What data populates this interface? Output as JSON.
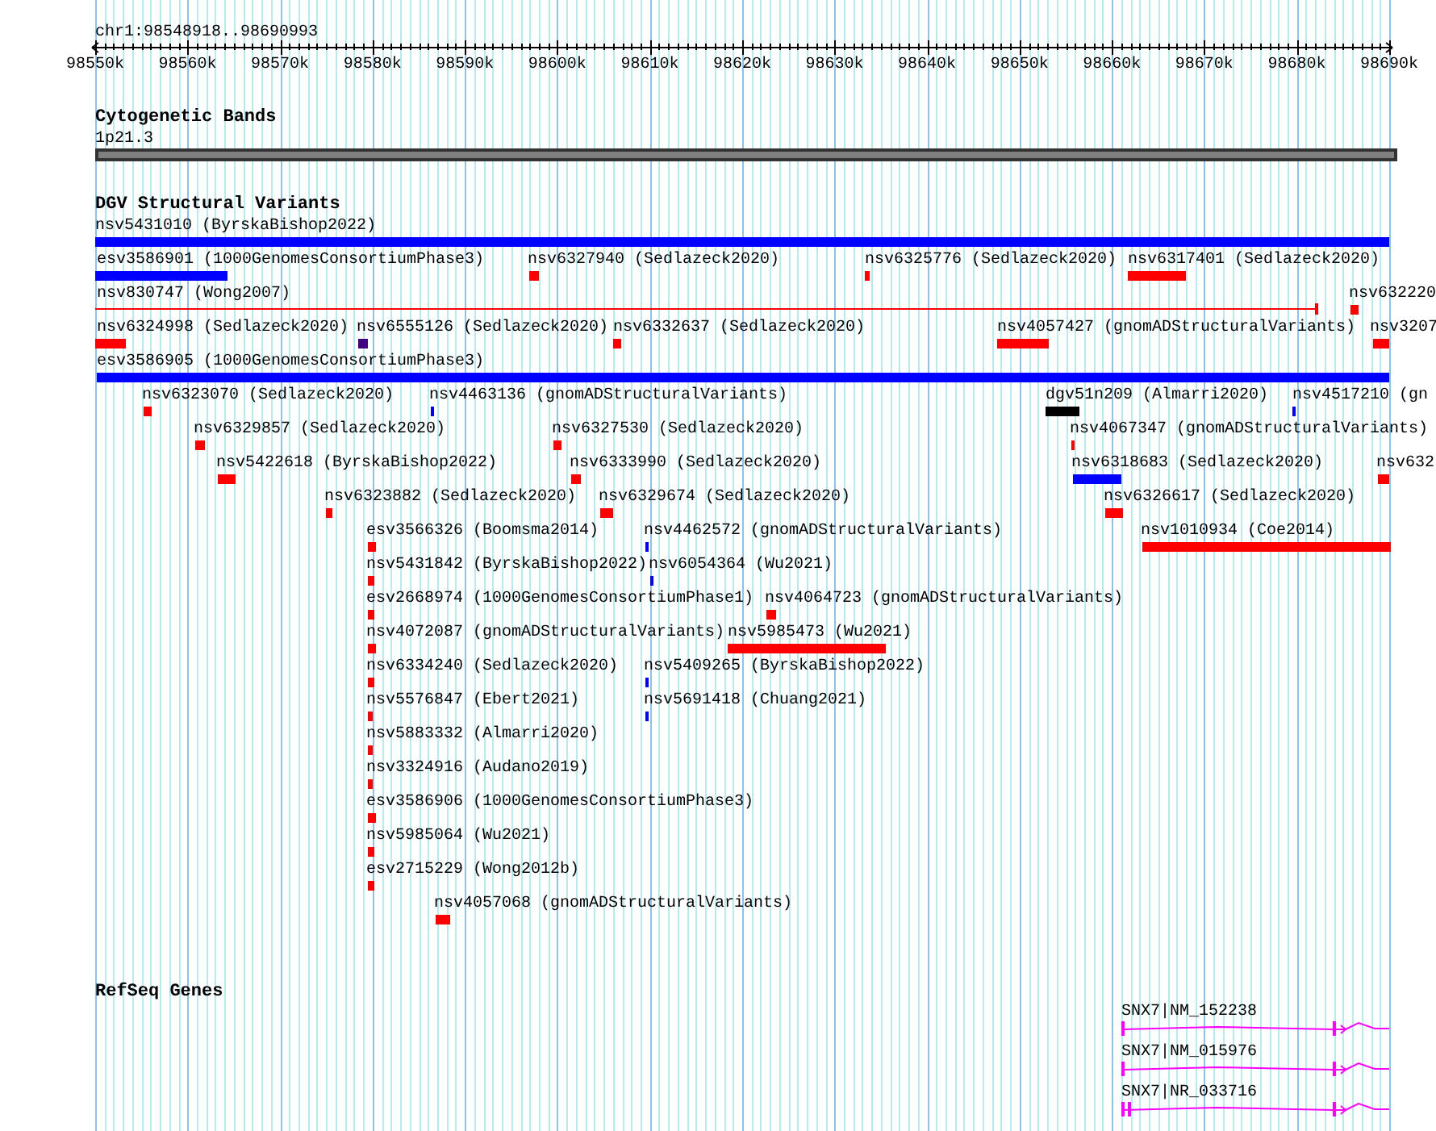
{
  "ruler": {
    "location": "chr1:98548918..98690993",
    "ticks": [
      "98550k",
      "98560k",
      "98570k",
      "98580k",
      "98590k",
      "98600k",
      "98610k",
      "98620k",
      "98630k",
      "98640k",
      "98650k",
      "98660k",
      "98670k",
      "98680k",
      "98690k"
    ]
  },
  "cytogenetic_bands": {
    "title": "Cytogenetic Bands",
    "band": "1p21.3"
  },
  "dgv": {
    "title": "DGV Structural Variants",
    "features": [
      {
        "label": "nsv5431010 (ByrskaBishop2022)",
        "color": "#0000ff",
        "kind": "bar"
      },
      {
        "label": "esv3586901 (1000GenomesConsortiumPhase3)",
        "color": "#0000ff",
        "kind": "bar"
      },
      {
        "label": "nsv6327940 (Sedlazeck2020)",
        "color": "#ff0000",
        "kind": "bar"
      },
      {
        "label": "nsv6325776 (Sedlazeck2020)",
        "color": "#ff0000",
        "kind": "bar"
      },
      {
        "label": "nsv6317401 (Sedlazeck2020)",
        "color": "#ff0000",
        "kind": "bar"
      },
      {
        "label": "nsv830747 (Wong2007)",
        "color": "#ff0000",
        "kind": "line"
      },
      {
        "label": "nsv632220",
        "color": "#ff0000",
        "kind": "bar"
      },
      {
        "label": "nsv6324998 (Sedlazeck2020)",
        "color": "#ff0000",
        "kind": "bar"
      },
      {
        "label": "nsv6555126 (Sedlazeck2020)",
        "color": "#400080",
        "kind": "bar"
      },
      {
        "label": "nsv6332637 (Sedlazeck2020)",
        "color": "#ff0000",
        "kind": "bar"
      },
      {
        "label": "nsv4057427 (gnomADStructuralVariants)",
        "color": "#ff0000",
        "kind": "bar"
      },
      {
        "label": "nsv3207",
        "color": "#ff0000",
        "kind": "bar"
      },
      {
        "label": "esv3586905 (1000GenomesConsortiumPhase3)",
        "color": "#0000ff",
        "kind": "bar"
      },
      {
        "label": "nsv6323070 (Sedlazeck2020)",
        "color": "#ff0000",
        "kind": "bar"
      },
      {
        "label": "nsv4463136 (gnomADStructuralVariants)",
        "color": "#0000ff",
        "kind": "bar"
      },
      {
        "label": "dgv51n209 (Almarri2020)",
        "color": "#000000",
        "kind": "bar"
      },
      {
        "label": "nsv4517210 (gn",
        "color": "#0000ff",
        "kind": "bar"
      },
      {
        "label": "nsv6329857 (Sedlazeck2020)",
        "color": "#ff0000",
        "kind": "bar"
      },
      {
        "label": "nsv6327530 (Sedlazeck2020)",
        "color": "#ff0000",
        "kind": "bar"
      },
      {
        "label": "nsv4067347 (gnomADStructuralVariants)",
        "color": "#ff0000",
        "kind": "bar"
      },
      {
        "label": "nsv5422618 (ByrskaBishop2022)",
        "color": "#ff0000",
        "kind": "bar"
      },
      {
        "label": "nsv6333990 (Sedlazeck2020)",
        "color": "#ff0000",
        "kind": "bar"
      },
      {
        "label": "nsv6318683 (Sedlazeck2020)",
        "color": "#0000ff",
        "kind": "bar"
      },
      {
        "label": "nsv632",
        "color": "#ff0000",
        "kind": "bar"
      },
      {
        "label": "nsv6323882 (Sedlazeck2020)",
        "color": "#ff0000",
        "kind": "bar"
      },
      {
        "label": "nsv6329674 (Sedlazeck2020)",
        "color": "#ff0000",
        "kind": "bar"
      },
      {
        "label": "nsv6326617 (Sedlazeck2020)",
        "color": "#ff0000",
        "kind": "bar"
      },
      {
        "label": "esv3566326 (Boomsma2014)",
        "color": "#ff0000",
        "kind": "bar"
      },
      {
        "label": "nsv4462572 (gnomADStructuralVariants)",
        "color": "#0000ff",
        "kind": "bar"
      },
      {
        "label": "nsv1010934 (Coe2014)",
        "color": "#ff0000",
        "kind": "bar"
      },
      {
        "label": "nsv5431842 (ByrskaBishop2022)",
        "color": "#ff0000",
        "kind": "bar"
      },
      {
        "label": "nsv6054364 (Wu2021)",
        "color": "#0000ff",
        "kind": "bar"
      },
      {
        "label": "esv2668974 (1000GenomesConsortiumPhase1)",
        "color": "#ff0000",
        "kind": "bar"
      },
      {
        "label": "nsv4064723 (gnomADStructuralVariants)",
        "color": "#ff0000",
        "kind": "bar"
      },
      {
        "label": "nsv4072087 (gnomADStructuralVariants)",
        "color": "#ff0000",
        "kind": "bar"
      },
      {
        "label": "nsv5985473 (Wu2021)",
        "color": "#ff0000",
        "kind": "bar"
      },
      {
        "label": "nsv6334240 (Sedlazeck2020)",
        "color": "#ff0000",
        "kind": "bar"
      },
      {
        "label": "nsv5409265 (ByrskaBishop2022)",
        "color": "#0000ff",
        "kind": "bar"
      },
      {
        "label": "nsv5576847 (Ebert2021)",
        "color": "#ff0000",
        "kind": "bar"
      },
      {
        "label": "nsv5691418 (Chuang2021)",
        "color": "#0000ff",
        "kind": "bar"
      },
      {
        "label": "nsv5883332 (Almarri2020)",
        "color": "#ff0000",
        "kind": "bar"
      },
      {
        "label": "nsv3324916 (Audano2019)",
        "color": "#ff0000",
        "kind": "bar"
      },
      {
        "label": "esv3586906 (1000GenomesConsortiumPhase3)",
        "color": "#ff0000",
        "kind": "bar"
      },
      {
        "label": "nsv5985064 (Wu2021)",
        "color": "#ff0000",
        "kind": "bar"
      },
      {
        "label": "esv2715229 (Wong2012b)",
        "color": "#ff0000",
        "kind": "bar"
      },
      {
        "label": "nsv4057068 (gnomADStructuralVariants)",
        "color": "#ff0000",
        "kind": "bar"
      }
    ]
  },
  "refseq_genes": {
    "title": "RefSeq Genes",
    "genes": [
      {
        "label": "SNX7|NM_152238"
      },
      {
        "label": "SNX7|NM_015976"
      },
      {
        "label": "SNX7|NR_033716"
      }
    ]
  }
}
